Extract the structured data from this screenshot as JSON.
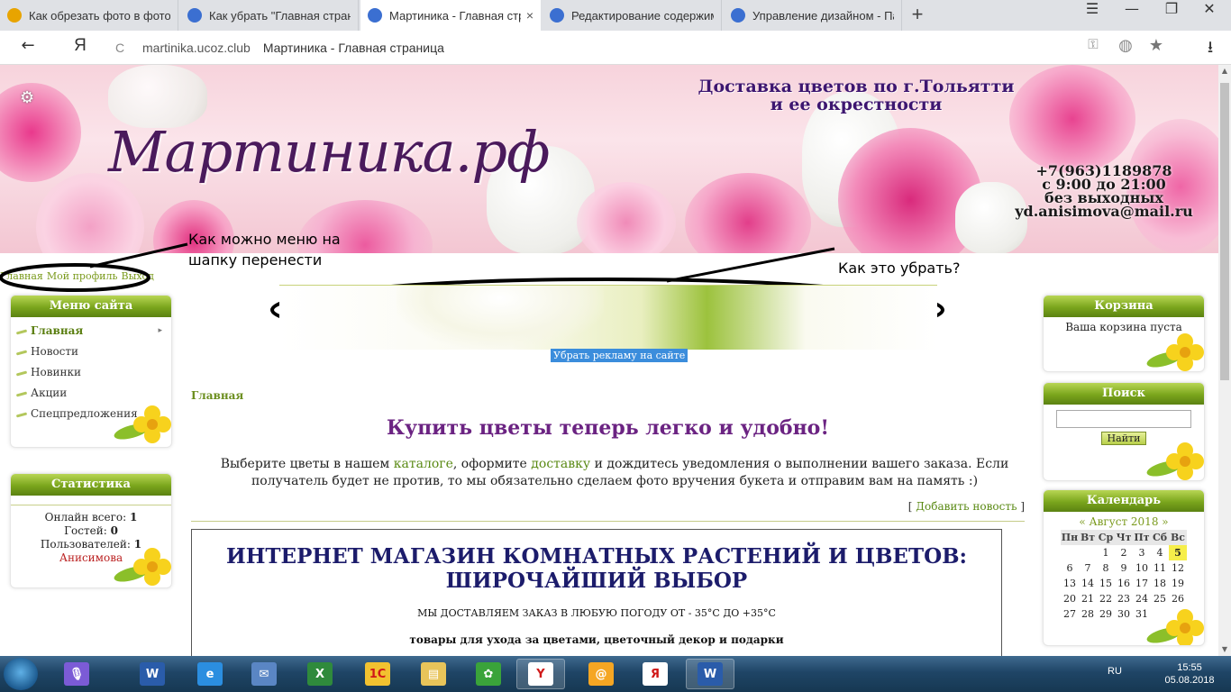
{
  "browser": {
    "tabs": [
      {
        "title": "Как обрезать фото в фотош",
        "icon_color": "#e8a400",
        "active": false,
        "closable": false
      },
      {
        "title": "Как убрать \"Главная страни",
        "icon_color": "#3b6fd1",
        "active": false,
        "closable": false
      },
      {
        "title": "Мартиника - Главная стр",
        "icon_color": "#3b6fd1",
        "active": true,
        "closable": true
      },
      {
        "title": "Редактирование содержим",
        "icon_color": "#3b6fd1",
        "active": false,
        "closable": false
      },
      {
        "title": "Управление дизайном - Па",
        "icon_color": "#3b6fd1",
        "active": false,
        "closable": false
      }
    ],
    "new_tab": "+",
    "close_glyph": "×",
    "window_controls": {
      "menu": "☰",
      "minimize": "—",
      "maximize": "❐",
      "close": "✕"
    },
    "nav": {
      "back": "←",
      "yandex": "Я",
      "reload": "C"
    },
    "address": {
      "domain": "martinika.ucoz.club",
      "page_title": "Мартиника - Главная страница"
    },
    "address_icons": {
      "key": "⚿",
      "protect": "◍",
      "bookmark": "★",
      "download": "⭳"
    }
  },
  "header": {
    "logo": "Мартиника.рф",
    "tagline": [
      "Доставка цветов по г.Тольятти",
      "и ее окрестности"
    ],
    "contacts": [
      "+7(963)1189878",
      "с 9:00 до 21:00",
      "без выходных",
      "yd.anisimova@mail.ru"
    ],
    "settings_icon": "⚙"
  },
  "user_nav": [
    "Главная",
    "Мой профиль",
    "Выход"
  ],
  "annotations": {
    "menu_note": [
      "Как можно меню на",
      "шапку перенести"
    ],
    "banner_note": "Как это убрать?"
  },
  "ad_remove": "Убрать рекламу на сайте",
  "left_menu": {
    "title": "Меню сайта",
    "items": [
      "Главная",
      "Новости",
      "Новинки",
      "Акции",
      "Спецпредложения"
    ],
    "arrow": "▸"
  },
  "stats": {
    "title": "Статистика",
    "online_label": "Онлайн всего:",
    "online_value": "1",
    "guests_label": "Гостей:",
    "guests_value": "0",
    "users_label": "Пользователей:",
    "users_value": "1",
    "user_name": "Анисимова"
  },
  "cart": {
    "title": "Корзина",
    "empty_text": "Ваша корзина пуста"
  },
  "search": {
    "title": "Поиск",
    "button": "Найти"
  },
  "calendar": {
    "title": "Календарь",
    "month_label": "«  Август 2018  »",
    "weekdays": [
      "Пн",
      "Вт",
      "Ср",
      "Чт",
      "Пт",
      "Сб",
      "Вс"
    ],
    "weeks": [
      [
        "",
        "",
        "1",
        "2",
        "3",
        "4",
        "5"
      ],
      [
        "6",
        "7",
        "8",
        "9",
        "10",
        "11",
        "12"
      ],
      [
        "13",
        "14",
        "15",
        "16",
        "17",
        "18",
        "19"
      ],
      [
        "20",
        "21",
        "22",
        "23",
        "24",
        "25",
        "26"
      ],
      [
        "27",
        "28",
        "29",
        "30",
        "31",
        "",
        ""
      ]
    ],
    "today": "5"
  },
  "content": {
    "breadcrumb": "Главная",
    "heading": "Купить цветы теперь легко и удобно!",
    "intro_1": "Выберите цветы в нашем ",
    "intro_link_1": "каталоге",
    "intro_2": ", оформите ",
    "intro_link_2": "доставку",
    "intro_3": " и дождитесь уведомления о выполнении вашего заказа. Если получатель будет не против, то мы обязательно сделаем фото вручения букета и отправим вам на память :)",
    "add_news_open": "[ ",
    "add_news": "Добавить новость",
    "add_news_close": " ]",
    "shop_title": "ИНТЕРНЕТ МАГАЗИН КОМНАТНЫХ РАСТЕНИЙ И ЦВЕТОВ: ШИРОЧАЙШИЙ ВЫБОР",
    "shop_line": "МЫ ДОСТАВЛЯЕМ ЗАКАЗ В ЛЮБУЮ ПОГОДУ ОТ - 35°С ДО +35°С",
    "shop_line2": "товары для ухода за цветами, цветочный декор и подарки"
  },
  "taskbar": {
    "apps": [
      {
        "name": "voice",
        "glyph": "🎙",
        "color": "#7b5bd6",
        "open": false
      },
      {
        "name": "word",
        "glyph": "W",
        "color": "#2a5caa",
        "open": false
      },
      {
        "name": "ie",
        "glyph": "e",
        "color": "#2b8ee0",
        "open": false
      },
      {
        "name": "mail",
        "glyph": "✉",
        "color": "#5a86c4",
        "open": false
      },
      {
        "name": "excel",
        "glyph": "X",
        "color": "#2f8a3c",
        "open": false
      },
      {
        "name": "1c",
        "glyph": "1С",
        "color": "#f2c230",
        "open": false
      },
      {
        "name": "explorer",
        "glyph": "▤",
        "color": "#e8c45a",
        "open": false
      },
      {
        "name": "icq",
        "glyph": "✿",
        "color": "#3aa33a",
        "open": false
      },
      {
        "name": "yandex",
        "glyph": "Y",
        "color": "#ffffff",
        "open": true
      },
      {
        "name": "mailru-agent",
        "glyph": "@",
        "color": "#f5a623",
        "open": false
      },
      {
        "name": "yandex-browser",
        "glyph": "Я",
        "color": "#ffffff",
        "open": false
      },
      {
        "name": "word-open",
        "glyph": "W",
        "color": "#2a5caa",
        "open": true
      }
    ],
    "language": "RU",
    "time": "15:55",
    "date": "05.08.2018"
  }
}
